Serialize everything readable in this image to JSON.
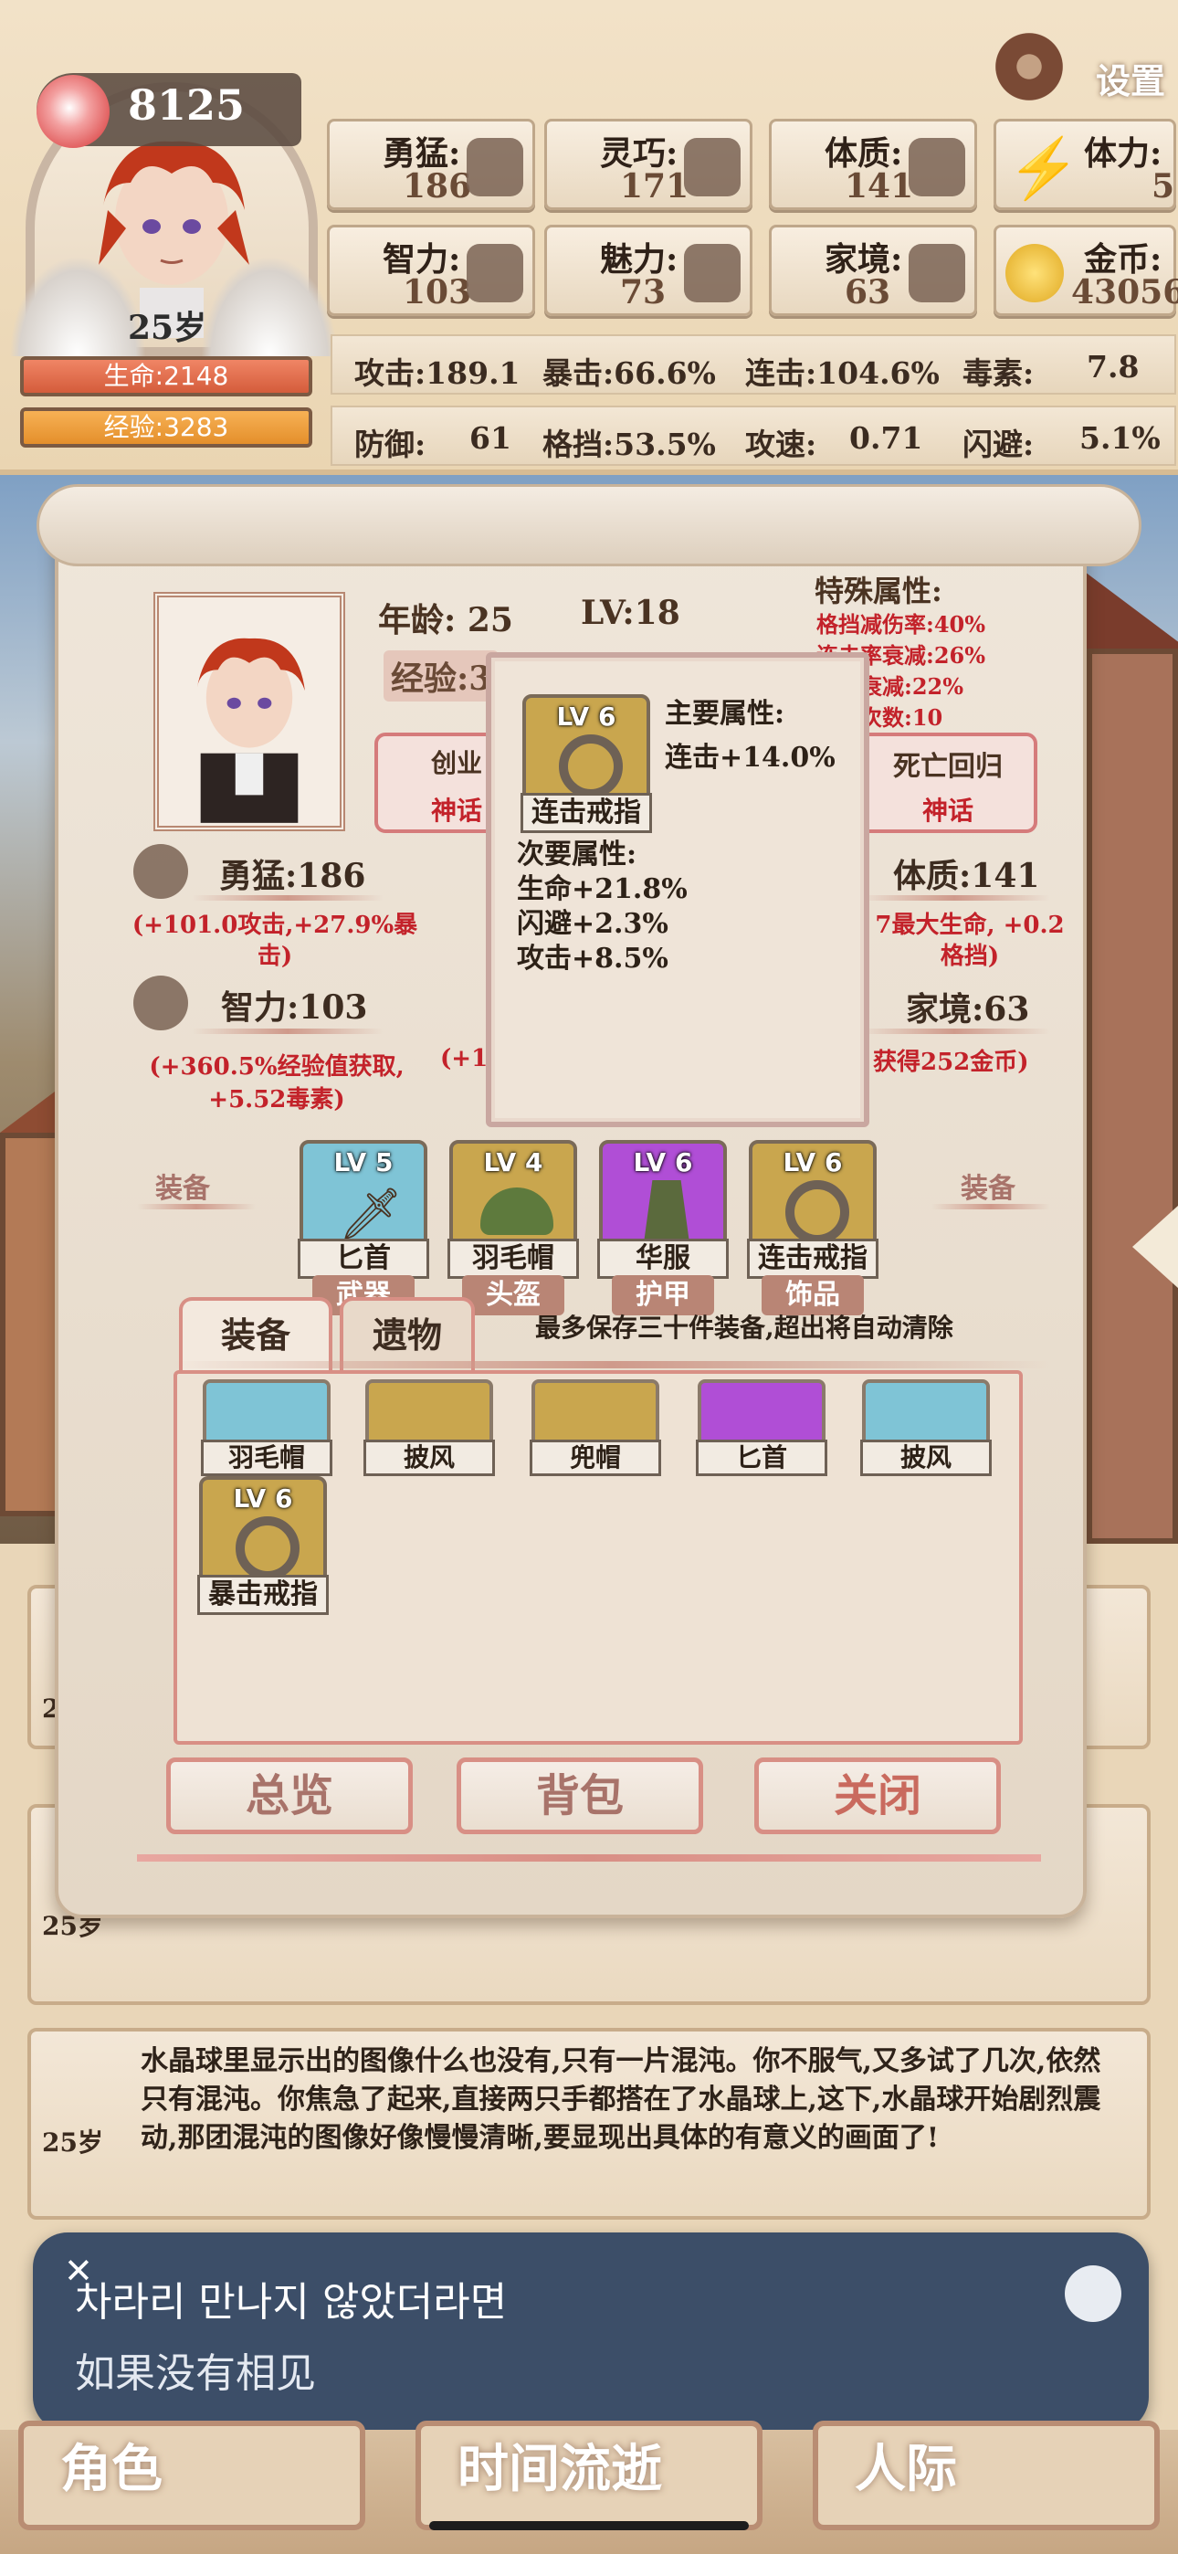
{
  "header": {
    "score": "8125",
    "age_small": "25岁",
    "hp_label": "生命:2148",
    "xp_label": "经验:3283",
    "settings_label": "设置",
    "stats": [
      {
        "label": "勇猛:",
        "value": "186"
      },
      {
        "label": "灵巧:",
        "value": "171"
      },
      {
        "label": "体质:",
        "value": "141"
      },
      {
        "label": "体力:",
        "value": "5"
      },
      {
        "label": "智力:",
        "value": "103"
      },
      {
        "label": "魅力:",
        "value": "73"
      },
      {
        "label": "家境:",
        "value": "63"
      },
      {
        "label": "金币:",
        "value": "43056"
      }
    ],
    "combat_row1": [
      "攻击:189.1",
      "暴击:66.6%",
      "连击:104.6%",
      "毒素:",
      "7.8"
    ],
    "combat_row2": [
      "防御:",
      "61",
      "格挡:53.5%",
      "攻速:",
      "0.71",
      "闪避:",
      "5.1%"
    ]
  },
  "dialog": {
    "age_label": "年龄: 25",
    "level_label": "LV:18",
    "exp_partial": "经验:3",
    "special_title": "特殊属性:",
    "special_lines": [
      "格挡减伤率:40%",
      "连击率衰减:26%",
      "伤害衰减:22%",
      "连击次数:10"
    ],
    "talent_left": "创业",
    "talent_left_tag": "神话",
    "talent_right": "死亡回归",
    "talent_right_tag": "神话",
    "attr_brave": "勇猛:186",
    "attr_brave_desc": "(+101.0攻击,+27.9%暴击)",
    "attr_con": "体质:141",
    "attr_con_desc": "7最大生命, +0.2格挡)",
    "attr_int": "智力:103",
    "attr_int_desc": "(+360.5%经验值获取, +5.52毒素)",
    "attr_int_partial": "(+14",
    "attr_family": "家境:63",
    "attr_family_desc": "获得252金币)",
    "equip_side_left": "装备",
    "equip_side_right": "装备",
    "equipped": [
      {
        "lv": "LV 5",
        "name": "匕首",
        "slot": "武器",
        "color": "#7fc4d6"
      },
      {
        "lv": "LV 4",
        "name": "羽毛帽",
        "slot": "头盔",
        "color": "#c9a64e"
      },
      {
        "lv": "LV 6",
        "name": "华服",
        "slot": "护甲",
        "color": "#b04ed6"
      },
      {
        "lv": "LV 6",
        "name": "连击戒指",
        "slot": "饰品",
        "color": "#c9a64e"
      }
    ],
    "tab_equip": "装备",
    "tab_relic": "遗物",
    "notice": "最多保存三十件装备,超出将自动清除",
    "bag_items": [
      {
        "name": "羽毛帽",
        "color": "#7fc4d6"
      },
      {
        "name": "披风",
        "color": "#c9a64e"
      },
      {
        "name": "兜帽",
        "color": "#c9a64e"
      },
      {
        "name": "匕首",
        "color": "#b04ed6"
      },
      {
        "name": "披风",
        "color": "#7fc4d6"
      }
    ],
    "bag_item_big": {
      "lv": "LV 6",
      "name": "暴击戒指",
      "color": "#c9a64e"
    },
    "btn_overview": "总览",
    "btn_bag": "背包",
    "btn_close": "关闭"
  },
  "tooltip": {
    "lv": "LV 6",
    "item_name": "连击戒指",
    "main_title": "主要属性:",
    "main_lines": [
      "连击+14.0%"
    ],
    "sub_title": "次要属性:",
    "sub_lines": [
      "生命+21.8%",
      "闪避+2.3%",
      "攻击+8.5%"
    ]
  },
  "log": {
    "cards": [
      {
        "age": "25岁",
        "text": ""
      },
      {
        "age": "25岁",
        "text": ""
      },
      {
        "age": "25岁",
        "text": "水晶球里显示出的图像什么也没有,只有一片混沌。你不服气,又多试了几次,依然只有混沌。你焦急了起来,直接两只手都搭在了水晶球上,这下,水晶球开始剧烈震动,那团混沌的图像好像慢慢清晰,要显现出具体的有意义的画面了!"
      }
    ]
  },
  "subtitle": {
    "korean": "차라리 만나지 않았더라면",
    "chinese": "如果没有相见",
    "close_glyph": "✕"
  },
  "nav": {
    "items": [
      "角色",
      "时间流逝",
      "人际"
    ]
  }
}
